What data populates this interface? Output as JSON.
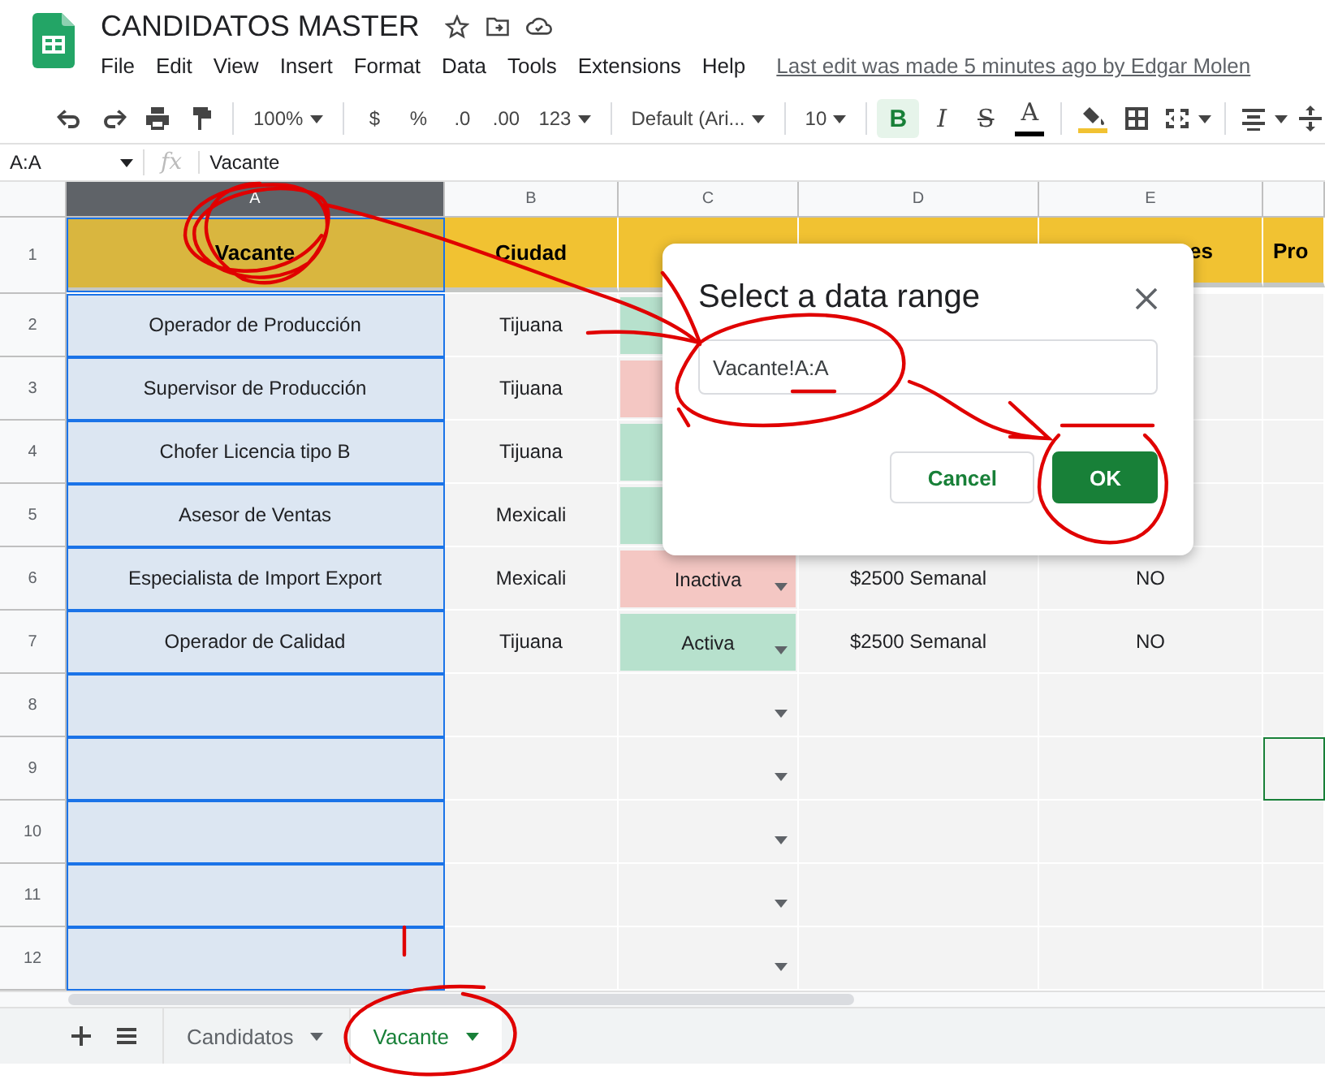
{
  "document": {
    "title": "CANDIDATOS MASTER",
    "menu": [
      "File",
      "Edit",
      "View",
      "Insert",
      "Format",
      "Data",
      "Tools",
      "Extensions",
      "Help"
    ],
    "last_edit": "Last edit was made 5 minutes ago by Edgar Molen"
  },
  "toolbar": [
    {
      "kind": "undo"
    },
    {
      "kind": "redo"
    },
    {
      "kind": "print"
    },
    {
      "kind": "paint"
    },
    {
      "kind": "separator"
    },
    {
      "kind": "dropdown",
      "label": "100%"
    },
    {
      "kind": "separator"
    },
    {
      "kind": "text",
      "label": "$"
    },
    {
      "kind": "text",
      "label": "%"
    },
    {
      "kind": "decimal",
      "label": ".0"
    },
    {
      "kind": "decimal",
      "label": ".00"
    },
    {
      "kind": "dropdown",
      "label": "123"
    },
    {
      "kind": "separator"
    },
    {
      "kind": "dropdown",
      "label": "Default (Ari..."
    },
    {
      "kind": "separator"
    },
    {
      "kind": "dropdown",
      "label": "10"
    },
    {
      "kind": "separator"
    },
    {
      "kind": "toggle",
      "label": "B",
      "selected": true
    },
    {
      "kind": "toggle",
      "label": "I",
      "selected": false
    },
    {
      "kind": "toggle",
      "label": "S",
      "selected": false
    },
    {
      "kind": "color",
      "label": "A",
      "color": "#000000"
    },
    {
      "kind": "separator"
    },
    {
      "kind": "fill",
      "color": "#f1c232"
    },
    {
      "kind": "borders"
    },
    {
      "kind": "merge"
    },
    {
      "kind": "separator"
    },
    {
      "kind": "align"
    },
    {
      "kind": "valign"
    }
  ],
  "formula_bar": {
    "name_box": "A:A",
    "function_label": "fx",
    "content": "Vacante"
  },
  "columns": [
    {
      "letter": "A",
      "selected": true
    },
    {
      "letter": "B",
      "selected": false
    },
    {
      "letter": "C",
      "selected": false
    },
    {
      "letter": "D",
      "selected": false
    },
    {
      "letter": "E",
      "selected": false
    },
    {
      "selected": false
    }
  ],
  "rows": [
    {
      "number": "1",
      "kind": "header",
      "cells": {
        "A": "Vacante",
        "B": "Ciudad",
        "E": "es",
        "F": "Pro"
      }
    },
    {
      "number": "2",
      "kind": "data",
      "cells": {
        "A": "Operador de Producción",
        "B": "Tijuana"
      },
      "status": {
        "color": "#b7e1cd"
      }
    },
    {
      "number": "3",
      "kind": "data",
      "cells": {
        "A": "Supervisor de Producción",
        "B": "Tijuana"
      },
      "status": {
        "color": "#f4c7c3"
      }
    },
    {
      "number": "4",
      "kind": "data",
      "cells": {
        "A": "Chofer Licencia tipo B",
        "B": "Tijuana"
      },
      "status": {
        "color": "#b7e1cd"
      }
    },
    {
      "number": "5",
      "kind": "data",
      "cells": {
        "A": "Asesor de Ventas",
        "B": "Mexicali"
      },
      "status": {
        "color": "#b7e1cd"
      }
    },
    {
      "number": "6",
      "kind": "data",
      "cells": {
        "A": "Especialista de Import Export",
        "B": "Mexicali",
        "D": "$2500 Semanal",
        "E": "NO"
      },
      "status": {
        "color": "#f4c7c3",
        "text": "Inactiva",
        "dropdown": true
      }
    },
    {
      "number": "7",
      "kind": "data",
      "cells": {
        "A": "Operador de Calidad",
        "B": "Tijuana",
        "D": "$2500 Semanal",
        "E": "NO"
      },
      "status": {
        "color": "#b7e1cd",
        "text": "Activa",
        "dropdown": true
      }
    },
    {
      "number": "8",
      "kind": "data",
      "cells": {},
      "status": {
        "dropdown": true
      }
    },
    {
      "number": "9",
      "kind": "data",
      "cells": {},
      "status": {
        "dropdown": true
      },
      "column_f_selected": true
    },
    {
      "number": "10",
      "kind": "data",
      "cells": {},
      "status": {
        "dropdown": true
      }
    },
    {
      "number": "11",
      "kind": "data",
      "cells": {},
      "status": {
        "dropdown": true
      }
    },
    {
      "number": "12",
      "kind": "data",
      "cells": {},
      "status": {
        "dropdown": true
      }
    }
  ],
  "sheet_tabs": [
    {
      "label": "Candidatos",
      "selected": false
    },
    {
      "label": "Vacante",
      "selected": true
    }
  ],
  "dialog": {
    "title": "Select a data range",
    "range_value": "Vacante!A:A",
    "buttons": [
      {
        "label": "Cancel",
        "kind": "secondary"
      },
      {
        "label": "OK",
        "kind": "primary"
      }
    ]
  }
}
